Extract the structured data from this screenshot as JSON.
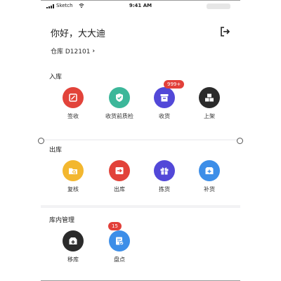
{
  "status_bar": {
    "carrier": "Sketch",
    "time": "9:41 AM"
  },
  "header": {
    "greeting": "你好，大大迪",
    "warehouse": "仓库 D12101",
    "logout_icon": "logout-icon"
  },
  "sections": [
    {
      "title": "入库",
      "items": [
        {
          "label": "签收",
          "icon": "sign-icon",
          "color": "#e2433a"
        },
        {
          "label": "收货前质检",
          "icon": "shield-check-icon",
          "color": "#3cb79a"
        },
        {
          "label": "收货",
          "icon": "inbox-icon",
          "color": "#5248d8",
          "badge": "999+"
        },
        {
          "label": "上架",
          "icon": "boxes-icon",
          "color": "#2b2b2b"
        }
      ]
    },
    {
      "title": "出库",
      "items": [
        {
          "label": "复核",
          "icon": "review-folder-icon",
          "color": "#f3b72f"
        },
        {
          "label": "出库",
          "icon": "outbound-icon",
          "color": "#e2433a"
        },
        {
          "label": "拣货",
          "icon": "gift-icon",
          "color": "#5248d8"
        },
        {
          "label": "补货",
          "icon": "replenish-icon",
          "color": "#3d8ee8"
        }
      ]
    },
    {
      "title": "库内管理",
      "items": [
        {
          "label": "移库",
          "icon": "transfer-icon",
          "color": "#2b2b2b"
        },
        {
          "label": "盘点",
          "icon": "inventory-check-icon",
          "color": "#3d8ee8",
          "badge": "15"
        }
      ]
    }
  ]
}
